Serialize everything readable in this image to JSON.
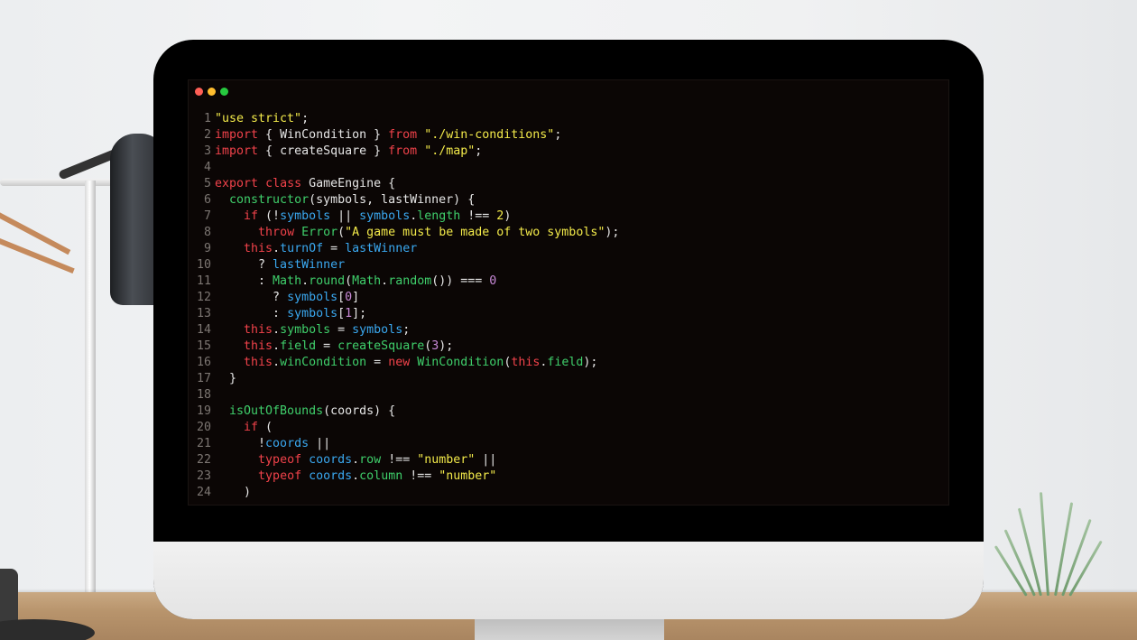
{
  "window": {
    "controls": [
      {
        "name": "close",
        "color": "#ff5f56"
      },
      {
        "name": "minimize",
        "color": "#ffbd2e"
      },
      {
        "name": "maximize",
        "color": "#27c93f"
      }
    ]
  },
  "colors": {
    "string": "#f3ea4a",
    "keyword": "#f0424a",
    "function": "#3fcf6b",
    "variable": "#3aa8f0",
    "number": "#c98ad8",
    "plain": "#e6e6e6",
    "line_number": "#7c7672",
    "editor_background": "#0b0605"
  },
  "code": {
    "lines": [
      {
        "n": "1",
        "tokens": [
          [
            "str",
            "\"use strict\""
          ],
          [
            "plain",
            ";"
          ]
        ]
      },
      {
        "n": "2",
        "tokens": [
          [
            "kw",
            "import"
          ],
          [
            "plain",
            " { WinCondition } "
          ],
          [
            "kw",
            "from"
          ],
          [
            "plain",
            " "
          ],
          [
            "str",
            "\"./win-conditions\""
          ],
          [
            "plain",
            ";"
          ]
        ]
      },
      {
        "n": "3",
        "tokens": [
          [
            "kw",
            "import"
          ],
          [
            "plain",
            " { createSquare } "
          ],
          [
            "kw",
            "from"
          ],
          [
            "plain",
            " "
          ],
          [
            "str",
            "\"./map\""
          ],
          [
            "plain",
            ";"
          ]
        ]
      },
      {
        "n": "4",
        "tokens": []
      },
      {
        "n": "5",
        "tokens": [
          [
            "kw",
            "export"
          ],
          [
            "plain",
            " "
          ],
          [
            "kw",
            "class"
          ],
          [
            "plain",
            " GameEngine {"
          ]
        ]
      },
      {
        "n": "6",
        "tokens": [
          [
            "plain",
            "  "
          ],
          [
            "fn",
            "constructor"
          ],
          [
            "plain",
            "(symbols, lastWinner) {"
          ]
        ]
      },
      {
        "n": "7",
        "tokens": [
          [
            "plain",
            "    "
          ],
          [
            "kw",
            "if"
          ],
          [
            "plain",
            " (!"
          ],
          [
            "var",
            "symbols"
          ],
          [
            "plain",
            " || "
          ],
          [
            "var",
            "symbols"
          ],
          [
            "plain",
            "."
          ],
          [
            "fn",
            "length"
          ],
          [
            "plain",
            " !== "
          ],
          [
            "str",
            "2"
          ],
          [
            "plain",
            ")"
          ]
        ]
      },
      {
        "n": "8",
        "tokens": [
          [
            "plain",
            "      "
          ],
          [
            "kw",
            "throw"
          ],
          [
            "plain",
            " "
          ],
          [
            "fn",
            "Error"
          ],
          [
            "plain",
            "("
          ],
          [
            "str",
            "\"A game must be made of two symbols\""
          ],
          [
            "plain",
            ");"
          ]
        ]
      },
      {
        "n": "9",
        "tokens": [
          [
            "plain",
            "    "
          ],
          [
            "kw",
            "this"
          ],
          [
            "plain",
            "."
          ],
          [
            "var",
            "turnOf"
          ],
          [
            "plain",
            " = "
          ],
          [
            "var",
            "lastWinner"
          ]
        ]
      },
      {
        "n": "10",
        "tokens": [
          [
            "plain",
            "      ? "
          ],
          [
            "var",
            "lastWinner"
          ]
        ]
      },
      {
        "n": "11",
        "tokens": [
          [
            "plain",
            "      : "
          ],
          [
            "fn",
            "Math"
          ],
          [
            "plain",
            "."
          ],
          [
            "fn",
            "round"
          ],
          [
            "plain",
            "("
          ],
          [
            "fn",
            "Math"
          ],
          [
            "plain",
            "."
          ],
          [
            "fn",
            "random"
          ],
          [
            "plain",
            "()) === "
          ],
          [
            "num",
            "0"
          ]
        ]
      },
      {
        "n": "12",
        "tokens": [
          [
            "plain",
            "        ? "
          ],
          [
            "var",
            "symbols"
          ],
          [
            "plain",
            "["
          ],
          [
            "num",
            "0"
          ],
          [
            "plain",
            "]"
          ]
        ]
      },
      {
        "n": "13",
        "tokens": [
          [
            "plain",
            "        : "
          ],
          [
            "var",
            "symbols"
          ],
          [
            "plain",
            "["
          ],
          [
            "num",
            "1"
          ],
          [
            "plain",
            "];"
          ]
        ]
      },
      {
        "n": "14",
        "tokens": [
          [
            "plain",
            "    "
          ],
          [
            "kw",
            "this"
          ],
          [
            "plain",
            "."
          ],
          [
            "fn",
            "symbols"
          ],
          [
            "plain",
            " = "
          ],
          [
            "var",
            "symbols"
          ],
          [
            "plain",
            ";"
          ]
        ]
      },
      {
        "n": "15",
        "tokens": [
          [
            "plain",
            "    "
          ],
          [
            "kw",
            "this"
          ],
          [
            "plain",
            "."
          ],
          [
            "fn",
            "field"
          ],
          [
            "plain",
            " = "
          ],
          [
            "fn",
            "createSquare"
          ],
          [
            "plain",
            "("
          ],
          [
            "num",
            "3"
          ],
          [
            "plain",
            ");"
          ]
        ]
      },
      {
        "n": "16",
        "tokens": [
          [
            "plain",
            "    "
          ],
          [
            "kw",
            "this"
          ],
          [
            "plain",
            "."
          ],
          [
            "fn",
            "winCondition"
          ],
          [
            "plain",
            " = "
          ],
          [
            "kw",
            "new"
          ],
          [
            "plain",
            " "
          ],
          [
            "fn",
            "WinCondition"
          ],
          [
            "plain",
            "("
          ],
          [
            "kw",
            "this"
          ],
          [
            "plain",
            "."
          ],
          [
            "fn",
            "field"
          ],
          [
            "plain",
            ");"
          ]
        ]
      },
      {
        "n": "17",
        "tokens": [
          [
            "plain",
            "  }"
          ]
        ]
      },
      {
        "n": "18",
        "tokens": []
      },
      {
        "n": "19",
        "tokens": [
          [
            "plain",
            "  "
          ],
          [
            "fn",
            "isOutOfBounds"
          ],
          [
            "plain",
            "(coords) {"
          ]
        ]
      },
      {
        "n": "20",
        "tokens": [
          [
            "plain",
            "    "
          ],
          [
            "kw",
            "if"
          ],
          [
            "plain",
            " ("
          ]
        ]
      },
      {
        "n": "21",
        "tokens": [
          [
            "plain",
            "      !"
          ],
          [
            "var",
            "coords"
          ],
          [
            "plain",
            " ||"
          ]
        ]
      },
      {
        "n": "22",
        "tokens": [
          [
            "plain",
            "      "
          ],
          [
            "kw",
            "typeof"
          ],
          [
            "plain",
            " "
          ],
          [
            "var",
            "coords"
          ],
          [
            "plain",
            "."
          ],
          [
            "fn",
            "row"
          ],
          [
            "plain",
            " !== "
          ],
          [
            "str",
            "\"number\""
          ],
          [
            "plain",
            " ||"
          ]
        ]
      },
      {
        "n": "23",
        "tokens": [
          [
            "plain",
            "      "
          ],
          [
            "kw",
            "typeof"
          ],
          [
            "plain",
            " "
          ],
          [
            "var",
            "coords"
          ],
          [
            "plain",
            "."
          ],
          [
            "fn",
            "column"
          ],
          [
            "plain",
            " !== "
          ],
          [
            "str",
            "\"number\""
          ]
        ]
      },
      {
        "n": "24",
        "tokens": [
          [
            "plain",
            "    )"
          ]
        ]
      }
    ]
  }
}
